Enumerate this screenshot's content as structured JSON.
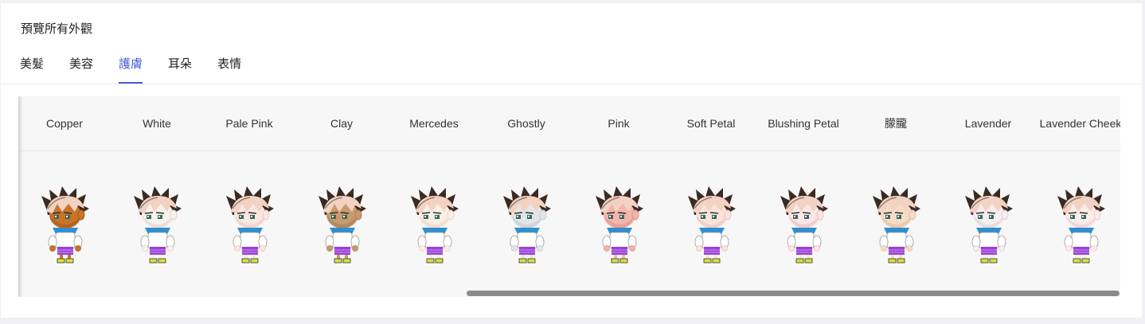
{
  "card": {
    "title": "預覽所有外觀"
  },
  "tabs": [
    {
      "label": "美髮",
      "active": false
    },
    {
      "label": "美容",
      "active": false
    },
    {
      "label": "護膚",
      "active": true
    },
    {
      "label": "耳朵",
      "active": false
    },
    {
      "label": "表情",
      "active": false
    }
  ],
  "skins": [
    {
      "name": "Copper",
      "skin_color": "#c8742a",
      "shade": "#a65a1c"
    },
    {
      "name": "White",
      "skin_color": "#f7f2ee",
      "shade": "#ddd3cc"
    },
    {
      "name": "Pale Pink",
      "skin_color": "#fbe6e3",
      "shade": "#ecc9c3"
    },
    {
      "name": "Clay",
      "skin_color": "#c89a6e",
      "shade": "#a67d56"
    },
    {
      "name": "Mercedes",
      "skin_color": "#fbeee4",
      "shade": "#e8d4c4"
    },
    {
      "name": "Ghostly",
      "skin_color": "#e2e6ea",
      "shade": "#c4cad0"
    },
    {
      "name": "Pink",
      "skin_color": "#f4b5ac",
      "shade": "#e0918a"
    },
    {
      "name": "Soft Petal",
      "skin_color": "#fbe2dc",
      "shade": "#eac5be"
    },
    {
      "name": "Blushing Petal",
      "skin_color": "#fbe6e6",
      "shade": "#f0b7bf"
    },
    {
      "name": "朦朧",
      "skin_color": "#f5dcc6",
      "shade": "#e2bea2"
    },
    {
      "name": "Lavender",
      "skin_color": "#f6eef0",
      "shade": "#ddd0d6"
    },
    {
      "name": "Lavender Cheek",
      "skin_color": "#fbecea",
      "shade": "#ecc9cf"
    }
  ],
  "colors": {
    "accent": "#4a5bd4",
    "hair": "#f2d2c2",
    "hair_dark": "#3b2a22",
    "scarf": "#2f8fd0",
    "shirt": "#ffffff",
    "pants": "#9b3fd6",
    "shoes": "#d8e23a"
  }
}
